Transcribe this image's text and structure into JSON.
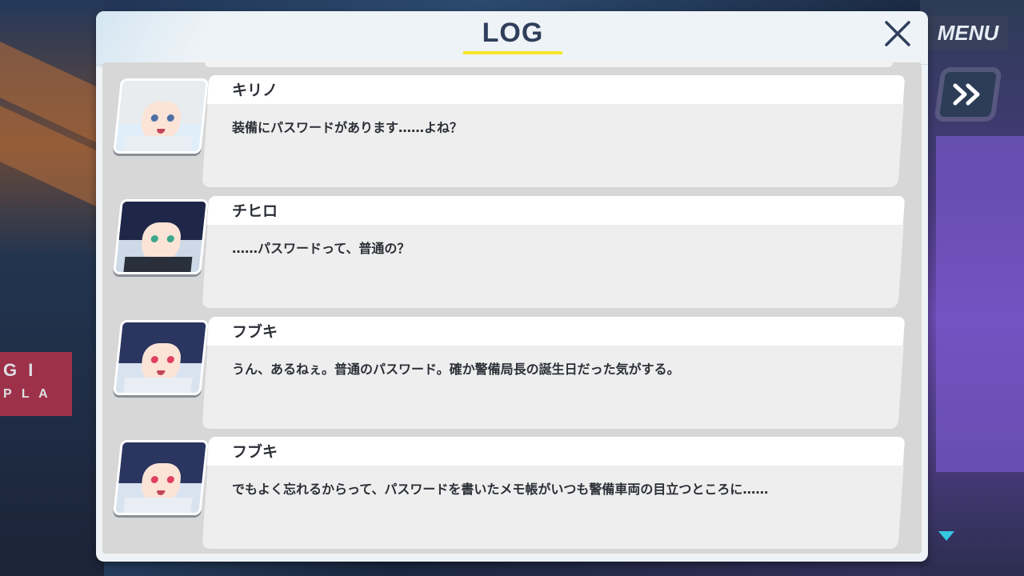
{
  "header": {
    "title": "LOG"
  },
  "menu": {
    "label": "MENU"
  },
  "background": {
    "sign_top": "G I",
    "sign_bottom": "P L A"
  },
  "colors": {
    "accent_underline": "#f5e52a",
    "title": "#2f3f5b",
    "panel": "#eef3f7",
    "log_bg": "#d7d7d7",
    "down_arrow": "#35c8e0"
  },
  "icons": {
    "close": "close-icon",
    "skip": "fast-forward-icon",
    "scroll": "scroll-down-icon"
  },
  "entries": [
    {
      "name": "キリノ",
      "text": "装備にパスワードがあります……よね？",
      "avatar": "kirino-portrait"
    },
    {
      "name": "チヒロ",
      "text": "……パスワードって、普通の？",
      "avatar": "chihiro-portrait"
    },
    {
      "name": "フブキ",
      "text": "うん、あるねぇ。普通のパスワード。確か警備局長の誕生日だった気がする。",
      "avatar": "fubuki-portrait"
    },
    {
      "name": "フブキ",
      "text": "でもよく忘れるからって、パスワードを書いたメモ帳がいつも警備車両の目立つところに……",
      "avatar": "fubuki-portrait"
    }
  ]
}
